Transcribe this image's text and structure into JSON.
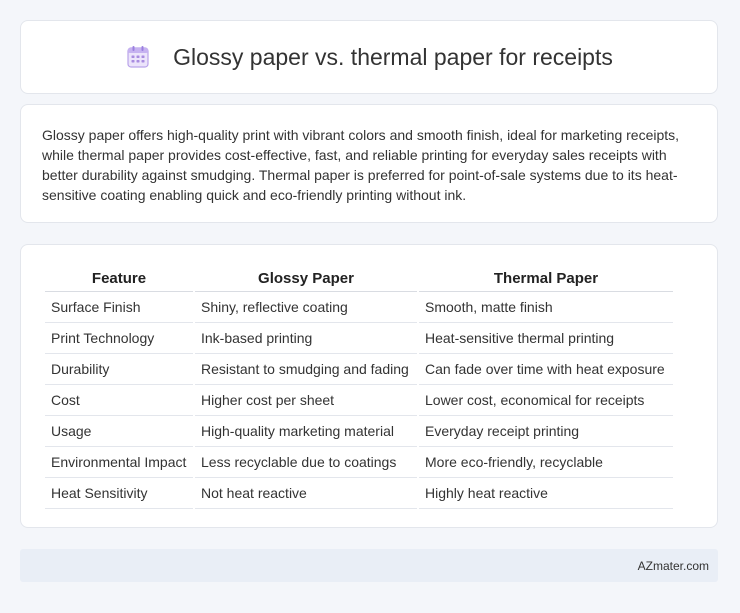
{
  "header": {
    "title": "Glossy paper vs. thermal paper for receipts",
    "icon": "calendar-icon"
  },
  "summary": {
    "text": "Glossy paper offers high-quality print with vibrant colors and smooth finish, ideal for marketing receipts, while thermal paper provides cost-effective, fast, and reliable printing for everyday sales receipts with better durability against smudging. Thermal paper is preferred for point-of-sale systems due to its heat-sensitive coating enabling quick and eco-friendly printing without ink."
  },
  "table": {
    "headers": [
      "Feature",
      "Glossy Paper",
      "Thermal Paper"
    ],
    "rows": [
      [
        "Surface Finish",
        "Shiny, reflective coating",
        "Smooth, matte finish"
      ],
      [
        "Print Technology",
        "Ink-based printing",
        "Heat-sensitive thermal printing"
      ],
      [
        "Durability",
        "Resistant to smudging and fading",
        "Can fade over time with heat exposure"
      ],
      [
        "Cost",
        "Higher cost per sheet",
        "Lower cost, economical for receipts"
      ],
      [
        "Usage",
        "High-quality marketing material",
        "Everyday receipt printing"
      ],
      [
        "Environmental Impact",
        "Less recyclable due to coatings",
        "More eco-friendly, recyclable"
      ],
      [
        "Heat Sensitivity",
        "Not heat reactive",
        "Highly heat reactive"
      ]
    ]
  },
  "footer": {
    "brand": "AZmater.com"
  },
  "colors": {
    "background": "#f4f6fa",
    "card": "#ffffff",
    "footer": "#e9eef6",
    "icon_accent": "#a98ce0"
  }
}
